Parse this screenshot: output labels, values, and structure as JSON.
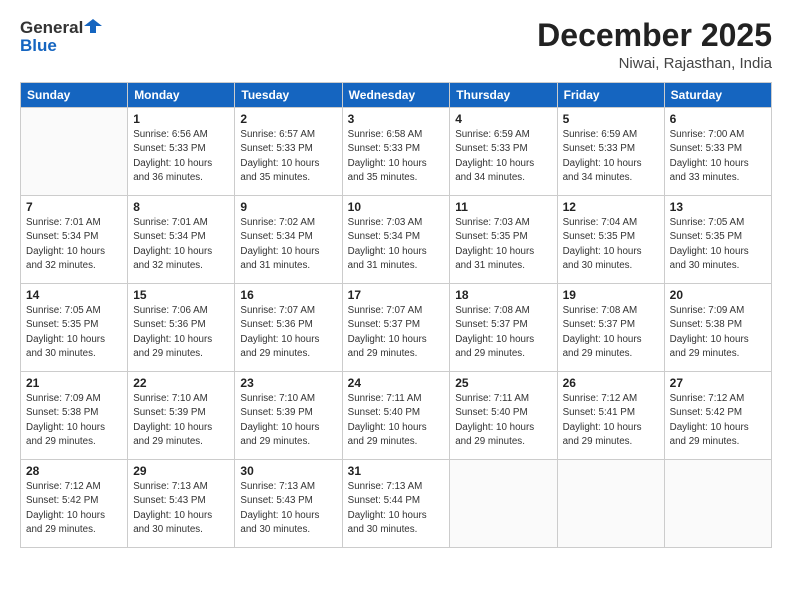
{
  "logo": {
    "line1": "General",
    "line2": "Blue"
  },
  "title": "December 2025",
  "subtitle": "Niwai, Rajasthan, India",
  "days_of_week": [
    "Sunday",
    "Monday",
    "Tuesday",
    "Wednesday",
    "Thursday",
    "Friday",
    "Saturday"
  ],
  "weeks": [
    [
      {
        "day": "",
        "info": ""
      },
      {
        "day": "1",
        "info": "Sunrise: 6:56 AM\nSunset: 5:33 PM\nDaylight: 10 hours\nand 36 minutes."
      },
      {
        "day": "2",
        "info": "Sunrise: 6:57 AM\nSunset: 5:33 PM\nDaylight: 10 hours\nand 35 minutes."
      },
      {
        "day": "3",
        "info": "Sunrise: 6:58 AM\nSunset: 5:33 PM\nDaylight: 10 hours\nand 35 minutes."
      },
      {
        "day": "4",
        "info": "Sunrise: 6:59 AM\nSunset: 5:33 PM\nDaylight: 10 hours\nand 34 minutes."
      },
      {
        "day": "5",
        "info": "Sunrise: 6:59 AM\nSunset: 5:33 PM\nDaylight: 10 hours\nand 34 minutes."
      },
      {
        "day": "6",
        "info": "Sunrise: 7:00 AM\nSunset: 5:33 PM\nDaylight: 10 hours\nand 33 minutes."
      }
    ],
    [
      {
        "day": "7",
        "info": "Sunrise: 7:01 AM\nSunset: 5:34 PM\nDaylight: 10 hours\nand 32 minutes."
      },
      {
        "day": "8",
        "info": "Sunrise: 7:01 AM\nSunset: 5:34 PM\nDaylight: 10 hours\nand 32 minutes."
      },
      {
        "day": "9",
        "info": "Sunrise: 7:02 AM\nSunset: 5:34 PM\nDaylight: 10 hours\nand 31 minutes."
      },
      {
        "day": "10",
        "info": "Sunrise: 7:03 AM\nSunset: 5:34 PM\nDaylight: 10 hours\nand 31 minutes."
      },
      {
        "day": "11",
        "info": "Sunrise: 7:03 AM\nSunset: 5:35 PM\nDaylight: 10 hours\nand 31 minutes."
      },
      {
        "day": "12",
        "info": "Sunrise: 7:04 AM\nSunset: 5:35 PM\nDaylight: 10 hours\nand 30 minutes."
      },
      {
        "day": "13",
        "info": "Sunrise: 7:05 AM\nSunset: 5:35 PM\nDaylight: 10 hours\nand 30 minutes."
      }
    ],
    [
      {
        "day": "14",
        "info": "Sunrise: 7:05 AM\nSunset: 5:35 PM\nDaylight: 10 hours\nand 30 minutes."
      },
      {
        "day": "15",
        "info": "Sunrise: 7:06 AM\nSunset: 5:36 PM\nDaylight: 10 hours\nand 29 minutes."
      },
      {
        "day": "16",
        "info": "Sunrise: 7:07 AM\nSunset: 5:36 PM\nDaylight: 10 hours\nand 29 minutes."
      },
      {
        "day": "17",
        "info": "Sunrise: 7:07 AM\nSunset: 5:37 PM\nDaylight: 10 hours\nand 29 minutes."
      },
      {
        "day": "18",
        "info": "Sunrise: 7:08 AM\nSunset: 5:37 PM\nDaylight: 10 hours\nand 29 minutes."
      },
      {
        "day": "19",
        "info": "Sunrise: 7:08 AM\nSunset: 5:37 PM\nDaylight: 10 hours\nand 29 minutes."
      },
      {
        "day": "20",
        "info": "Sunrise: 7:09 AM\nSunset: 5:38 PM\nDaylight: 10 hours\nand 29 minutes."
      }
    ],
    [
      {
        "day": "21",
        "info": "Sunrise: 7:09 AM\nSunset: 5:38 PM\nDaylight: 10 hours\nand 29 minutes."
      },
      {
        "day": "22",
        "info": "Sunrise: 7:10 AM\nSunset: 5:39 PM\nDaylight: 10 hours\nand 29 minutes."
      },
      {
        "day": "23",
        "info": "Sunrise: 7:10 AM\nSunset: 5:39 PM\nDaylight: 10 hours\nand 29 minutes."
      },
      {
        "day": "24",
        "info": "Sunrise: 7:11 AM\nSunset: 5:40 PM\nDaylight: 10 hours\nand 29 minutes."
      },
      {
        "day": "25",
        "info": "Sunrise: 7:11 AM\nSunset: 5:40 PM\nDaylight: 10 hours\nand 29 minutes."
      },
      {
        "day": "26",
        "info": "Sunrise: 7:12 AM\nSunset: 5:41 PM\nDaylight: 10 hours\nand 29 minutes."
      },
      {
        "day": "27",
        "info": "Sunrise: 7:12 AM\nSunset: 5:42 PM\nDaylight: 10 hours\nand 29 minutes."
      }
    ],
    [
      {
        "day": "28",
        "info": "Sunrise: 7:12 AM\nSunset: 5:42 PM\nDaylight: 10 hours\nand 29 minutes."
      },
      {
        "day": "29",
        "info": "Sunrise: 7:13 AM\nSunset: 5:43 PM\nDaylight: 10 hours\nand 30 minutes."
      },
      {
        "day": "30",
        "info": "Sunrise: 7:13 AM\nSunset: 5:43 PM\nDaylight: 10 hours\nand 30 minutes."
      },
      {
        "day": "31",
        "info": "Sunrise: 7:13 AM\nSunset: 5:44 PM\nDaylight: 10 hours\nand 30 minutes."
      },
      {
        "day": "",
        "info": ""
      },
      {
        "day": "",
        "info": ""
      },
      {
        "day": "",
        "info": ""
      }
    ]
  ]
}
